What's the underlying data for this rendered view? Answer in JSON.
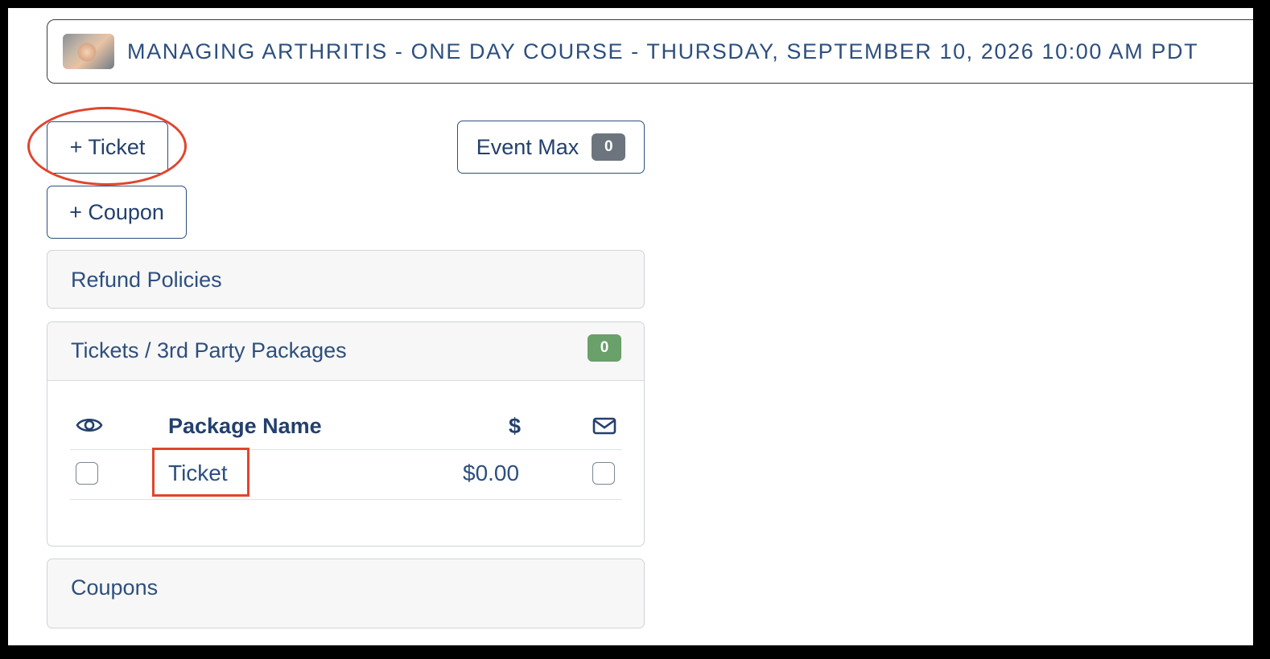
{
  "event": {
    "title": "MANAGING ARTHRITIS - ONE DAY COURSE - THURSDAY, SEPTEMBER 10, 2026 10:00 AM PDT"
  },
  "actions": {
    "add_ticket_label": "+ Ticket",
    "add_coupon_label": "+ Coupon",
    "event_max_label": "Event Max",
    "event_max_count": "0"
  },
  "sections": {
    "refund_policies": "Refund Policies",
    "tickets": {
      "title": "Tickets / 3rd Party Packages",
      "count": "0",
      "columns": {
        "visible_icon": "eye-icon",
        "name": "Package Name",
        "price": "$",
        "email_icon": "envelope-icon"
      },
      "rows": [
        {
          "name": "Ticket",
          "price": "$0.00",
          "visible": false,
          "email": false
        }
      ]
    },
    "coupons": "Coupons"
  },
  "colors": {
    "primary_text": "#2d4f7e",
    "annotation": "#e0452c",
    "badge_gray": "#6c757d",
    "badge_green": "#6aa06a"
  }
}
